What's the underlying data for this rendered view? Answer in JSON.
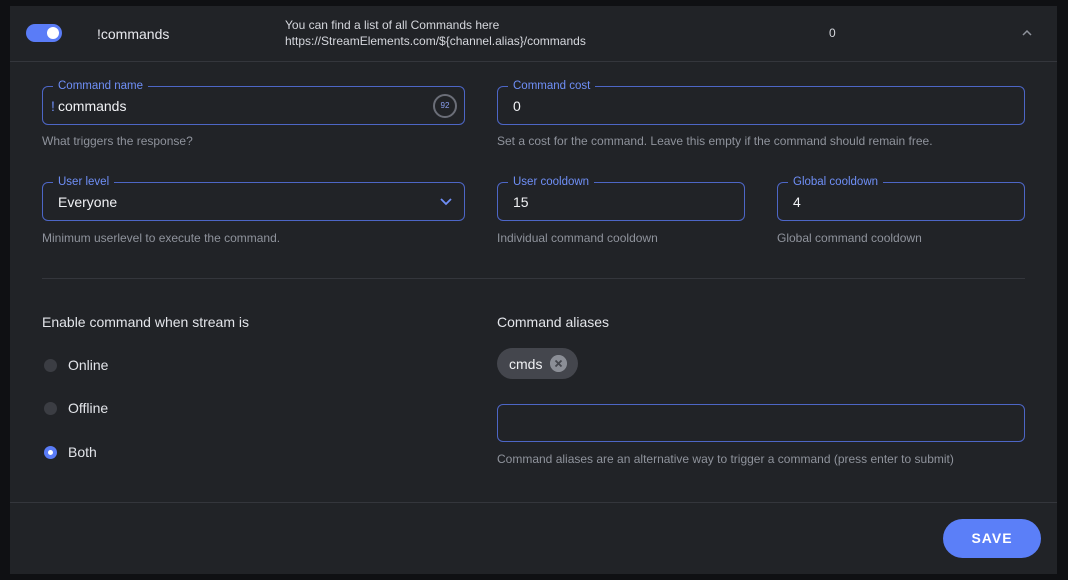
{
  "header": {
    "command_title": "!commands",
    "description_line1": "You can find a list of all Commands here",
    "description_line2": "https://StreamElements.com/${channel.alias}/commands",
    "count": "0"
  },
  "command_name": {
    "label": "Command name",
    "prefix": "!",
    "value": "commands",
    "char_counter": "92",
    "help": "What triggers the response?"
  },
  "command_cost": {
    "label": "Command cost",
    "value": "0",
    "help": "Set a cost for the command. Leave this empty if the command should remain free."
  },
  "user_level": {
    "label": "User level",
    "value": "Everyone",
    "help": "Minimum userlevel to execute the command."
  },
  "user_cooldown": {
    "label": "User cooldown",
    "value": "15",
    "help": "Individual command cooldown"
  },
  "global_cooldown": {
    "label": "Global cooldown",
    "value": "4",
    "help": "Global command cooldown"
  },
  "stream_state": {
    "title": "Enable command when stream is",
    "options": [
      "Online",
      "Offline",
      "Both"
    ],
    "selected": "Both"
  },
  "aliases": {
    "title": "Command aliases",
    "chips": [
      "cmds"
    ],
    "input_value": "",
    "help": "Command aliases are an alternative way to trigger a command (press enter to submit)"
  },
  "actions": {
    "save_label": "SAVE"
  },
  "colors": {
    "accent": "#5b7ff8",
    "panel": "#212327",
    "background": "#0f1013"
  }
}
